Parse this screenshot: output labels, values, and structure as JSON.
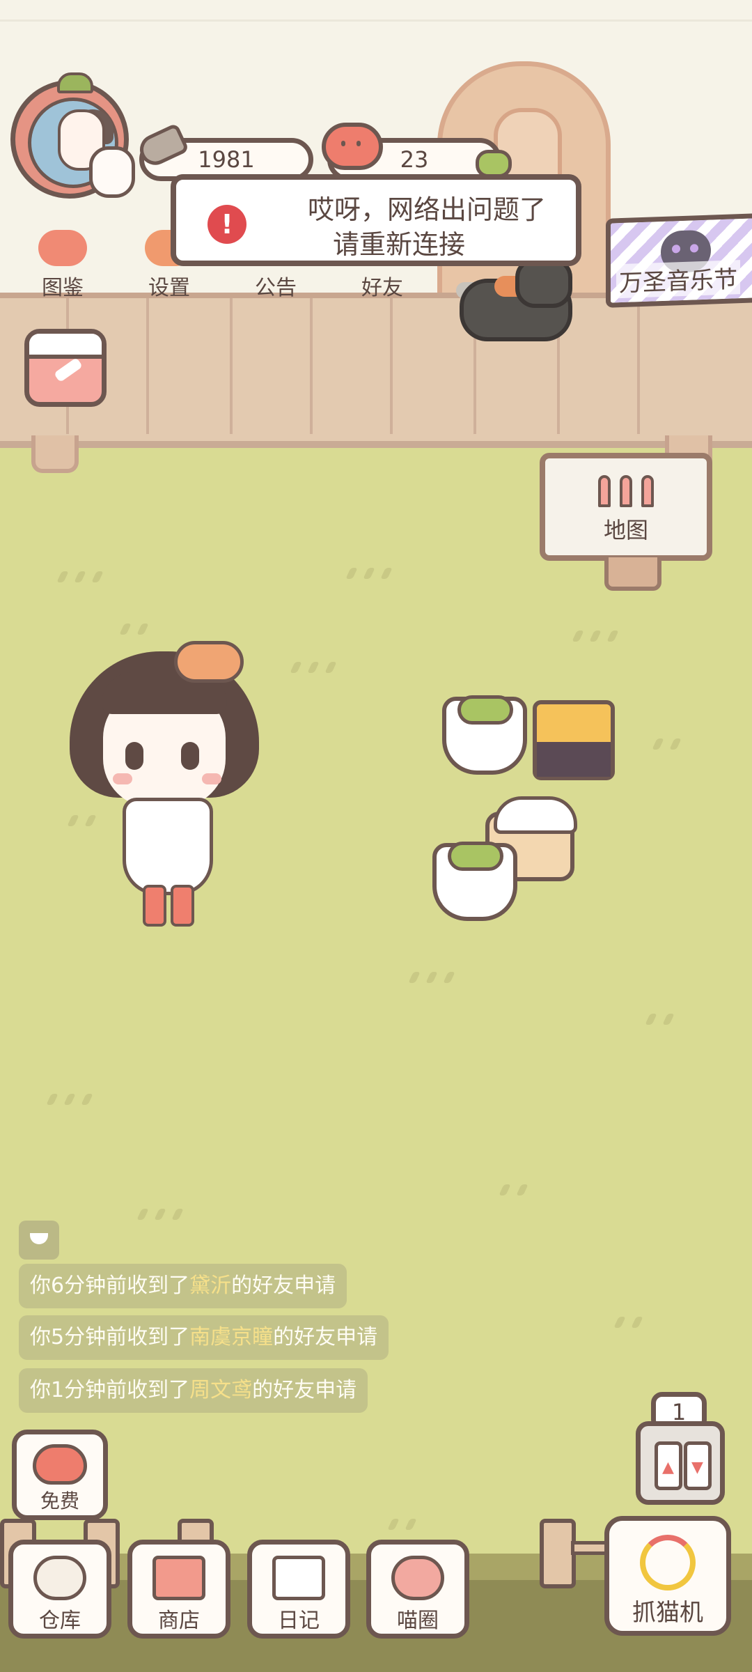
{
  "currency": {
    "fish": "1981",
    "hearts": "23"
  },
  "top_nav": [
    {
      "label": "图鉴"
    },
    {
      "label": "设置"
    },
    {
      "label": "公告"
    },
    {
      "label": "好友"
    }
  ],
  "event_banner": {
    "label": "万圣音乐节"
  },
  "error_dialog": {
    "line1": "哎呀，网络出问题了",
    "line2": "请重新连接"
  },
  "map_sign": {
    "label": "地图"
  },
  "messages": [
    {
      "prefix": "你6分钟前收到了",
      "name": "黛沂",
      "suffix": "的好友申请"
    },
    {
      "prefix": "你5分钟前收到了",
      "name": "南虞京瞳",
      "suffix": "的好友申请"
    },
    {
      "prefix": "你1分钟前收到了",
      "name": "周文鸢",
      "suffix": "的好友申请"
    }
  ],
  "free_button": {
    "label": "免费"
  },
  "bottom_nav": [
    {
      "label": "仓库"
    },
    {
      "label": "商店"
    },
    {
      "label": "日记"
    },
    {
      "label": "喵圈"
    }
  ],
  "claw_machine": {
    "count": "1",
    "label": "抓猫机"
  },
  "colors": {
    "grass": "#d9db93",
    "outline": "#6d5750",
    "highlight_name": "#f6e08a",
    "error_red": "#e04b4f"
  }
}
